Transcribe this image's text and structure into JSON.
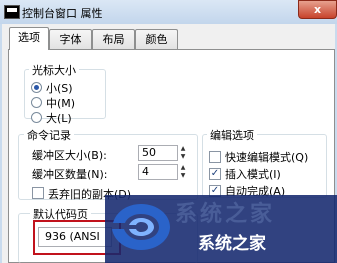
{
  "window": {
    "title": "控制台窗口 属性",
    "close_label": "x"
  },
  "tabs": [
    {
      "label": "选项",
      "active": true
    },
    {
      "label": "字体",
      "active": false
    },
    {
      "label": "布局",
      "active": false
    },
    {
      "label": "颜色",
      "active": false
    }
  ],
  "cursor_size": {
    "title": "光标大小",
    "options": [
      {
        "label": "小(S)",
        "selected": true
      },
      {
        "label": "中(M)",
        "selected": false
      },
      {
        "label": "大(L)",
        "selected": false
      }
    ]
  },
  "command_history": {
    "title": "命令记录",
    "buffer_size_label": "缓冲区大小(B):",
    "buffer_size_value": "50",
    "buffer_count_label": "缓冲区数量(N):",
    "buffer_count_value": "4",
    "discard_duplicates_label": "丢弃旧的副本(D)",
    "discard_duplicates_checked": false
  },
  "edit_options": {
    "title": "编辑选项",
    "items": [
      {
        "label": "快速编辑模式(Q)",
        "checked": false
      },
      {
        "label": "插入模式(I)",
        "checked": true
      },
      {
        "label": "自动完成(A)",
        "checked": true
      }
    ]
  },
  "default_codepage": {
    "title": "默认代码页",
    "value": "936 (ANSI"
  },
  "watermark": {
    "faded_text": "系统之家",
    "text": "系统之家"
  },
  "colors": {
    "highlight": "#c1121c",
    "accent": "#2b57a8",
    "watermark_bg": "#14286e"
  }
}
